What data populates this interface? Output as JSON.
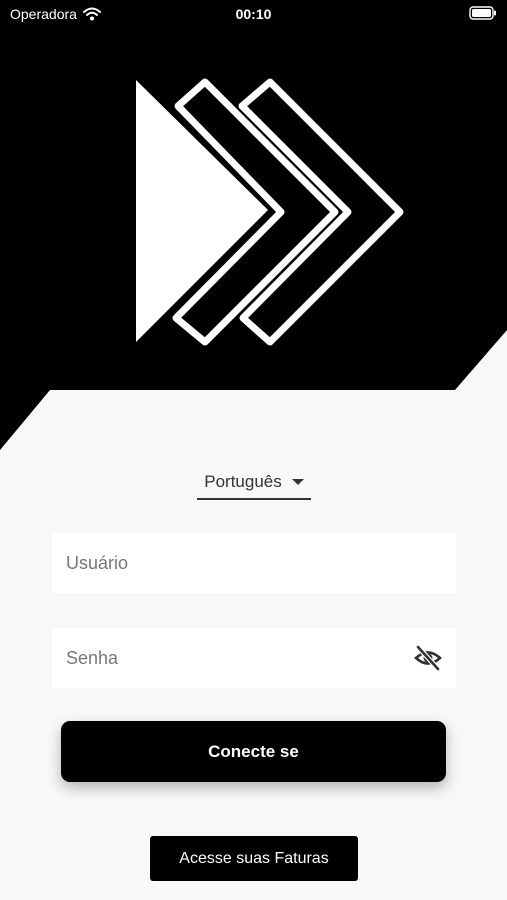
{
  "status_bar": {
    "carrier": "Operadora",
    "time": "00:10",
    "wifi_icon": "wifi-icon",
    "battery_icon": "battery-icon"
  },
  "logo": {
    "icon": "forward-arrows-logo"
  },
  "language": {
    "selected": "Português",
    "icon": "caret-down-icon"
  },
  "form": {
    "username_placeholder": "Usuário",
    "password_placeholder": "Senha",
    "password_toggle_icon": "eye-off-icon"
  },
  "buttons": {
    "login_label": "Conecte se",
    "invoices_label": "Acesse suas Faturas"
  },
  "colors": {
    "hero_background": "#000000",
    "page_background": "#f8f8f8",
    "primary_button": "#000000",
    "button_text": "#ffffff"
  }
}
